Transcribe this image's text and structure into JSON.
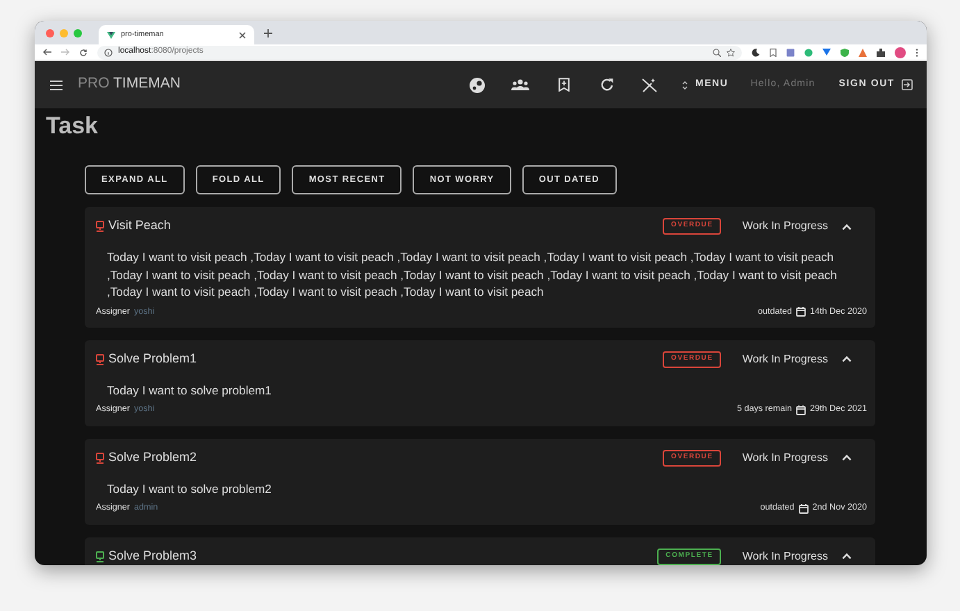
{
  "browser": {
    "tab_title": "pro-timeman",
    "url_host": "localhost",
    "url_rest": ":8080/projects"
  },
  "app_bar": {
    "brand_prefix": "PRO",
    "brand_name": "TIMEMAN",
    "menu_label": "MENU",
    "greeting": "Hello, Admin",
    "sign_out_label": "SIGN OUT"
  },
  "page_title": "Task",
  "filter_buttons": [
    "EXPAND ALL",
    "FOLD ALL",
    "MOST RECENT",
    "NOT WORRY",
    "OUT DATED"
  ],
  "tasks": [
    {
      "title": "Visit Peach",
      "badge": {
        "kind": "overdue",
        "label": "OVERDUE"
      },
      "status": "Work In Progress",
      "expanded": true,
      "description": "Today I want to visit peach ,Today I want to visit peach ,Today I want to visit peach ,Today I want to visit peach ,Today I want to visit peach ,Today I want to visit peach ,Today I want to visit peach ,Today I want to visit peach ,Today I want to visit peach ,Today I want to visit peach ,Today I want to visit peach ,Today I want to visit peach ,Today I want to visit peach",
      "assigner_label": "Assigner",
      "assigner": "yoshi",
      "remaining": "outdated",
      "due_date": "14th Dec 2020"
    },
    {
      "title": "Solve Problem1",
      "badge": {
        "kind": "overdue",
        "label": "OVERDUE"
      },
      "status": "Work In Progress",
      "expanded": true,
      "description": "Today I want to solve problem1",
      "assigner_label": "Assigner",
      "assigner": "yoshi",
      "remaining": "5 days remain",
      "due_date": "29th Dec 2021"
    },
    {
      "title": "Solve Problem2",
      "badge": {
        "kind": "overdue",
        "label": "OVERDUE"
      },
      "status": "Work In Progress",
      "expanded": true,
      "description": "Today I want to solve problem2",
      "assigner_label": "Assigner",
      "assigner": "admin",
      "remaining": "outdated",
      "due_date": "2nd Nov 2020"
    },
    {
      "title": "Solve Problem3",
      "badge": {
        "kind": "complete",
        "label": "COMPLETE"
      },
      "status": "Work In Progress",
      "expanded": true
    }
  ]
}
